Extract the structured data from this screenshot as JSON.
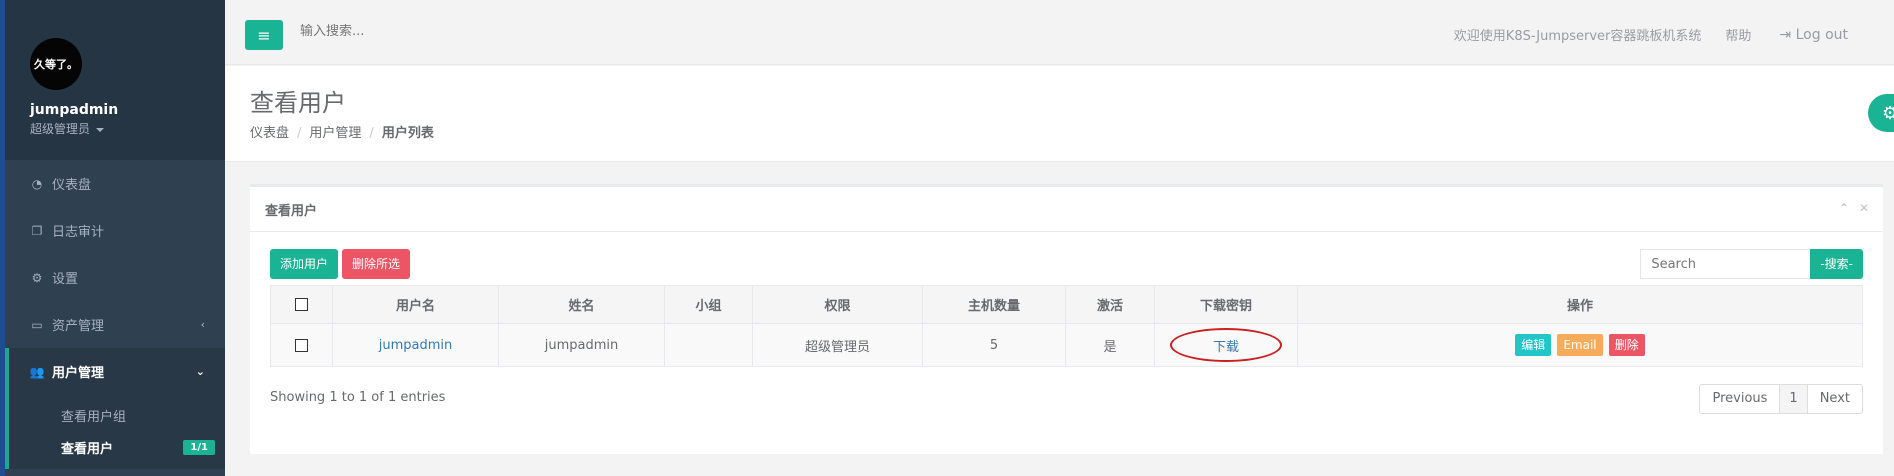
{
  "sidebar": {
    "avatar_text": "久等了。",
    "username": "jumpadmin",
    "role": "超级管理员",
    "items": [
      {
        "label": "仪表盘",
        "icon": "dashboard-icon"
      },
      {
        "label": "日志审计",
        "icon": "copy-icon"
      },
      {
        "label": "设置",
        "icon": "gears-icon"
      },
      {
        "label": "资产管理",
        "icon": "hdd-icon"
      },
      {
        "label": "用户管理",
        "icon": "users-icon"
      }
    ],
    "submenu": [
      {
        "label": "查看用户组"
      },
      {
        "label": "查看用户",
        "badge": "1/1"
      }
    ]
  },
  "topbar": {
    "search_placeholder": "输入搜索...",
    "welcome": "欢迎使用K8S-Jumpserver容器跳板机系统",
    "help": "帮助",
    "logout": "Log out"
  },
  "heading": {
    "title": "查看用户",
    "breadcrumb": [
      "仪表盘",
      "用户管理",
      "用户列表"
    ]
  },
  "panel": {
    "title": "查看用户",
    "add_button": "添加用户",
    "delete_button": "删除所选",
    "search_placeholder": "Search",
    "search_button": "-搜索-",
    "columns": [
      "用户名",
      "姓名",
      "小组",
      "权限",
      "主机数量",
      "激活",
      "下载密钥",
      "操作"
    ],
    "rows": [
      {
        "username": "jumpadmin",
        "name": "jumpadmin",
        "group": "",
        "role": "超级管理员",
        "hosts": "5",
        "active": "是",
        "download": "下载",
        "edit": "编辑",
        "email": "Email",
        "delete": "删除"
      }
    ],
    "info": "Showing 1 to 1 of 1 entries",
    "pager": {
      "prev": "Previous",
      "page": "1",
      "next": "Next"
    }
  },
  "colors": {
    "sidebar": "#2f4050",
    "accent": "#1ab394",
    "danger": "#ed5565",
    "warning": "#f8ac59",
    "info": "#23c6c8",
    "highlight_circle": "#cc1f1f"
  }
}
